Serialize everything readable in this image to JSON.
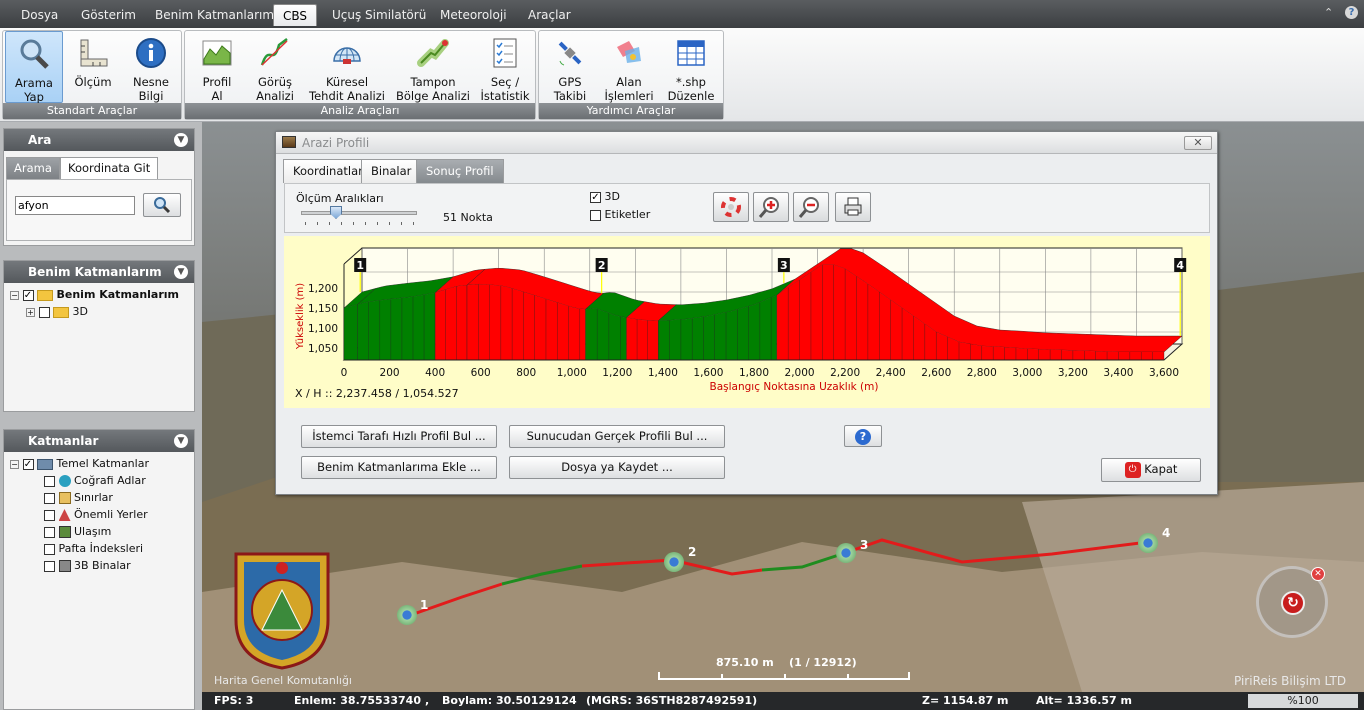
{
  "menu": {
    "items": [
      {
        "label": "Dosya"
      },
      {
        "label": "Gösterim"
      },
      {
        "label": "Benim Katmanlarım"
      },
      {
        "label": "CBS"
      },
      {
        "label": "Uçuş Similatörü"
      },
      {
        "label": "Meteoroloji"
      },
      {
        "label": "Araçlar"
      }
    ],
    "active_index": 3
  },
  "ribbon": {
    "groups": [
      {
        "label": "Standart Araçlar"
      },
      {
        "label": "Analiz Araçları"
      },
      {
        "label": "Yardımcı Araçlar"
      }
    ],
    "buttons": [
      {
        "line1": "Arama",
        "line2": "Yap",
        "icon": "magnifier-icon"
      },
      {
        "line1": "Ölçüm",
        "line2": "",
        "icon": "ruler-icon"
      },
      {
        "line1": "Nesne",
        "line2": "Bilgi",
        "icon": "info-icon"
      },
      {
        "line1": "Profil",
        "line2": "Al",
        "icon": "profile-chart-icon"
      },
      {
        "line1": "Görüş",
        "line2": "Analizi",
        "icon": "line-of-sight-icon"
      },
      {
        "line1": "Küresel",
        "line2": "Tehdit Analizi",
        "icon": "dome-icon"
      },
      {
        "line1": "Tampon",
        "line2": "Bölge Analizi",
        "icon": "buffer-zone-icon"
      },
      {
        "line1": "Seç /",
        "line2": "İstatistik",
        "icon": "checklist-icon"
      },
      {
        "line1": "GPS",
        "line2": "Takibi",
        "icon": "satellite-icon"
      },
      {
        "line1": "Alan",
        "line2": "İşlemleri",
        "icon": "area-shapes-icon"
      },
      {
        "line1": "*.shp",
        "line2": "Düzenle",
        "icon": "table-grid-icon"
      }
    ]
  },
  "search_panel": {
    "title": "Ara",
    "tabs": [
      "Arama",
      "Koordinata Git"
    ],
    "input_value": "afyon"
  },
  "my_layers_panel": {
    "title": "Benim Katmanlarım",
    "root": "Benim Katmanlarım",
    "child": "3D"
  },
  "layers_panel": {
    "title": "Katmanlar",
    "root": "Temel Katmanlar",
    "items": [
      "Coğrafi Adlar",
      "Sınırlar",
      "Önemli Yerler",
      "Ulaşım",
      "Pafta İndeksleri",
      "3B Binalar"
    ]
  },
  "dialog": {
    "title": "Arazi Profili",
    "tabs": [
      "Koordinatlar",
      "Binalar",
      "Sonuç Profil"
    ],
    "measure_label": "Ölçüm Aralıkları",
    "points_label": "51 Nokta",
    "slider_fraction": 0.27,
    "check_3d": "3D",
    "check_labels": "Etiketler",
    "coord_readout": "X / H :: 2,237.458  /  1,054.527",
    "buttons": {
      "client": "İstemci Tarafı Hızlı Profil Bul ...",
      "server": "Sunucudan Gerçek Profili Bul ...",
      "add": "Benim Katmanlarıma Ekle ...",
      "save": "Dosya ya Kaydet ...",
      "close": "Kapat"
    }
  },
  "chart_data": {
    "type": "area",
    "xlabel": "Başlangıç Noktasına Uzaklık (m)",
    "ylabel": "Yükseklik (m)",
    "xlim": [
      0,
      3600
    ],
    "ylim": [
      1020,
      1260
    ],
    "x_ticks": [
      "0",
      "200",
      "400",
      "600",
      "800",
      "1,000",
      "1,200",
      "1,400",
      "1,600",
      "1,800",
      "2,000",
      "2,200",
      "2,400",
      "2,600",
      "2,800",
      "3,000",
      "3,200",
      "3,400",
      "3,600"
    ],
    "y_ticks": [
      "1,050",
      "1,100",
      "1,150",
      "1,200"
    ],
    "x": [
      0,
      100,
      200,
      300,
      400,
      500,
      600,
      700,
      800,
      900,
      1000,
      1050,
      1100,
      1200,
      1300,
      1400,
      1500,
      1600,
      1700,
      1800,
      1900,
      2000,
      2100,
      2150,
      2200,
      2300,
      2400,
      2500,
      2600,
      2700,
      2800,
      2900,
      3000,
      3100,
      3200,
      3300,
      3400,
      3500,
      3600
    ],
    "y": [
      1150,
      1165,
      1172,
      1178,
      1188,
      1205,
      1210,
      1205,
      1188,
      1170,
      1152,
      1146,
      1150,
      1130,
      1120,
      1118,
      1122,
      1130,
      1142,
      1158,
      1182,
      1220,
      1258,
      1258,
      1248,
      1210,
      1170,
      1130,
      1090,
      1065,
      1055,
      1052,
      1048,
      1046,
      1044,
      1042,
      1040,
      1040,
      1040
    ],
    "segments": [
      {
        "x0": 0,
        "x1": 60,
        "status": "visible"
      },
      {
        "x0": 60,
        "x1": 400,
        "status": "visible"
      },
      {
        "x0": 400,
        "x1": 540,
        "status": "hidden"
      },
      {
        "x0": 540,
        "x1": 1060,
        "status": "hidden"
      },
      {
        "x0": 1060,
        "x1": 1240,
        "status": "visible"
      },
      {
        "x0": 1240,
        "x1": 1380,
        "status": "hidden"
      },
      {
        "x0": 1380,
        "x1": 1900,
        "status": "visible"
      },
      {
        "x0": 1900,
        "x1": 3600,
        "status": "hidden"
      }
    ],
    "markers": [
      {
        "label": "1",
        "x": 0
      },
      {
        "label": "2",
        "x": 1060
      },
      {
        "label": "3",
        "x": 1860
      },
      {
        "label": "4",
        "x": 3600
      }
    ],
    "colors": {
      "visible": "#008000",
      "hidden": "#ff0000"
    },
    "grid": true,
    "view": "3D"
  },
  "map": {
    "route_markers": [
      "1",
      "2",
      "3",
      "4"
    ],
    "watermark_left": "Harita Genel Komutanlığı",
    "watermark_right": "PiriReis Bilişim LTD",
    "scale_text": "875.10 m    (1 / 12912)"
  },
  "status": {
    "fps": "FPS: 3",
    "lat": "Enlem: 38.75533740",
    "lon": "Boylam: 30.50129124",
    "mgrs": "(MGRS: 36STH8287492591)",
    "z": "Z= 1154.87 m",
    "alt": "Alt= 1336.57 m",
    "zoom": "%100"
  }
}
